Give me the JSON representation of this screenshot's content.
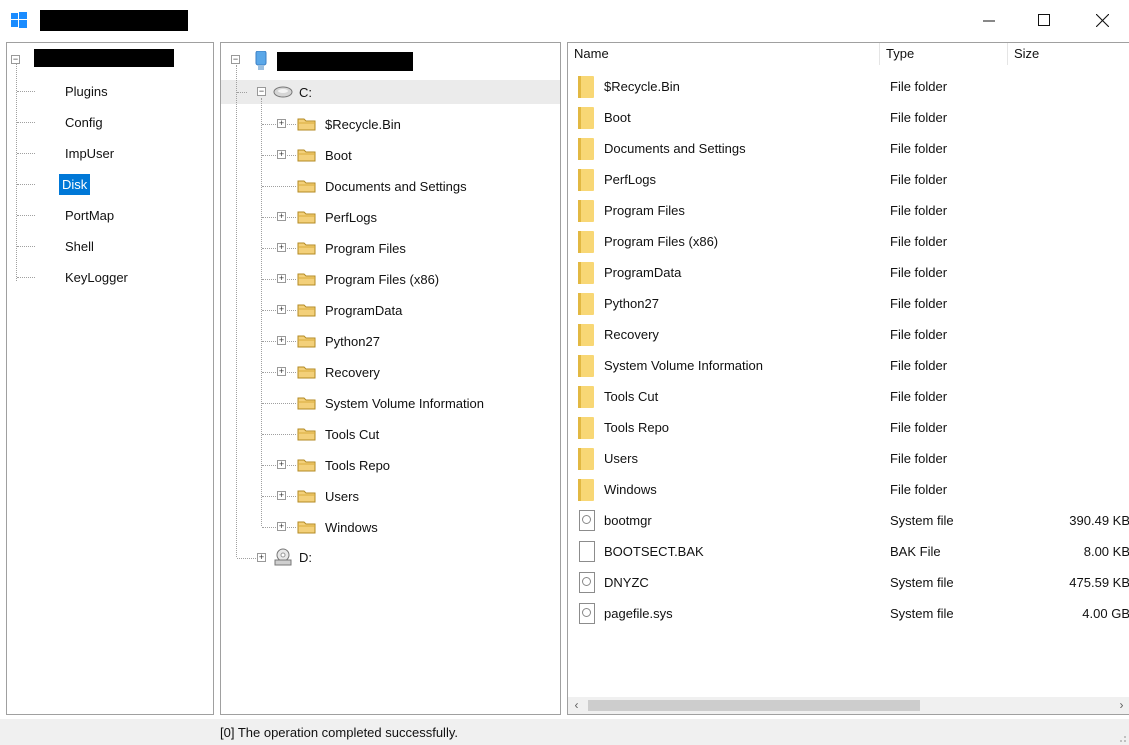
{
  "window": {
    "title": "",
    "controls": {
      "minimize": "minimize-icon",
      "maximize": "maximize-icon",
      "close": "close-icon"
    }
  },
  "nav": {
    "items": [
      {
        "label": "Plugins"
      },
      {
        "label": "Config"
      },
      {
        "label": "ImpUser"
      },
      {
        "label": "Disk",
        "selected": true
      },
      {
        "label": "PortMap"
      },
      {
        "label": "Shell"
      },
      {
        "label": "KeyLogger"
      }
    ]
  },
  "tree": {
    "drive_c": "C:",
    "drive_d": "D:",
    "folders": [
      {
        "label": "$Recycle.Bin",
        "expandable": true
      },
      {
        "label": "Boot",
        "expandable": true
      },
      {
        "label": "Documents and Settings",
        "expandable": false
      },
      {
        "label": "PerfLogs",
        "expandable": true
      },
      {
        "label": "Program Files",
        "expandable": true
      },
      {
        "label": "Program Files (x86)",
        "expandable": true
      },
      {
        "label": "ProgramData",
        "expandable": true
      },
      {
        "label": "Python27",
        "expandable": true
      },
      {
        "label": "Recovery",
        "expandable": true
      },
      {
        "label": "System Volume Information",
        "expandable": false
      },
      {
        "label": "Tools Cut",
        "expandable": false
      },
      {
        "label": "Tools Repo",
        "expandable": true
      },
      {
        "label": "Users",
        "expandable": true
      },
      {
        "label": "Windows",
        "expandable": true
      }
    ]
  },
  "list": {
    "columns": {
      "name": "Name",
      "type": "Type",
      "size": "Size"
    },
    "rows": [
      {
        "name": "$Recycle.Bin",
        "type": "File folder",
        "size": "",
        "kind": "folder"
      },
      {
        "name": "Boot",
        "type": "File folder",
        "size": "",
        "kind": "folder"
      },
      {
        "name": "Documents and Settings",
        "type": "File folder",
        "size": "",
        "kind": "folder"
      },
      {
        "name": "PerfLogs",
        "type": "File folder",
        "size": "",
        "kind": "folder"
      },
      {
        "name": "Program Files",
        "type": "File folder",
        "size": "",
        "kind": "folder"
      },
      {
        "name": "Program Files (x86)",
        "type": "File folder",
        "size": "",
        "kind": "folder"
      },
      {
        "name": "ProgramData",
        "type": "File folder",
        "size": "",
        "kind": "folder"
      },
      {
        "name": "Python27",
        "type": "File folder",
        "size": "",
        "kind": "folder"
      },
      {
        "name": "Recovery",
        "type": "File folder",
        "size": "",
        "kind": "folder"
      },
      {
        "name": "System Volume Information",
        "type": "File folder",
        "size": "",
        "kind": "folder"
      },
      {
        "name": "Tools Cut",
        "type": "File folder",
        "size": "",
        "kind": "folder"
      },
      {
        "name": "Tools Repo",
        "type": "File folder",
        "size": "",
        "kind": "folder"
      },
      {
        "name": "Users",
        "type": "File folder",
        "size": "",
        "kind": "folder"
      },
      {
        "name": "Windows",
        "type": "File folder",
        "size": "",
        "kind": "folder"
      },
      {
        "name": "bootmgr",
        "type": "System file",
        "size": "390.49 KB",
        "kind": "sysfile"
      },
      {
        "name": "BOOTSECT.BAK",
        "type": "BAK File",
        "size": "8.00 KB",
        "kind": "file"
      },
      {
        "name": "DNYZC",
        "type": "System file",
        "size": "475.59 KB",
        "kind": "sysfile"
      },
      {
        "name": "pagefile.sys",
        "type": "System file",
        "size": "4.00 GB",
        "kind": "sysfile"
      }
    ],
    "scroll_left": "‹",
    "scroll_right": "›"
  },
  "status": {
    "text": "[0] The operation completed successfully."
  },
  "colors": {
    "selection": "#0078d7",
    "folder": "#f8d775",
    "folder_edge": "#e2b842"
  }
}
